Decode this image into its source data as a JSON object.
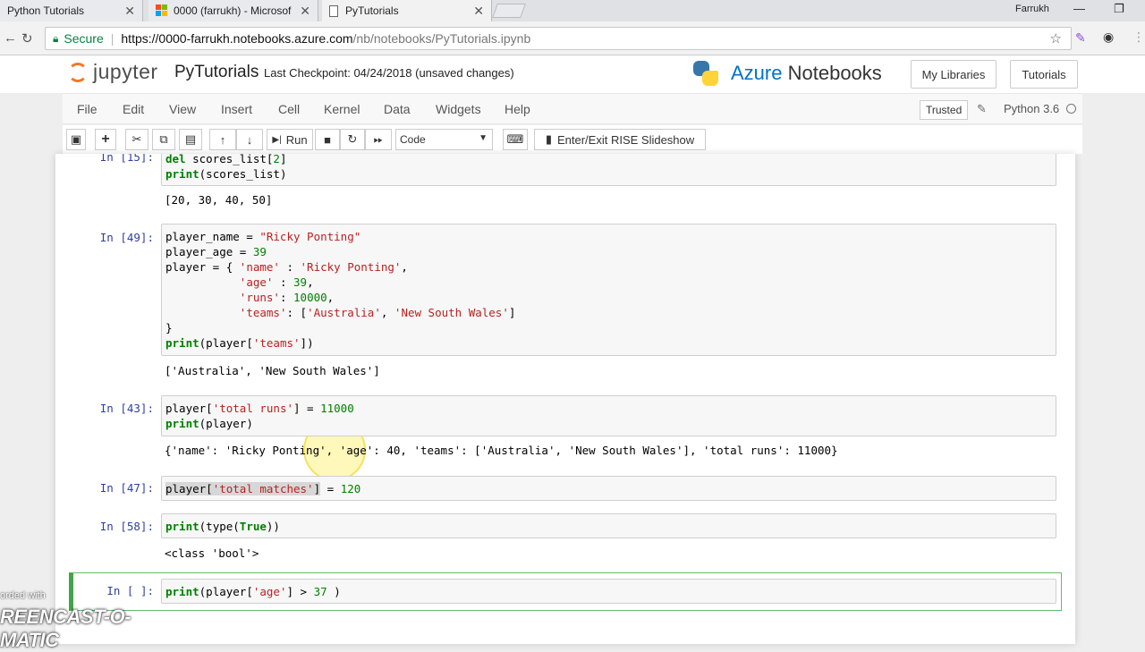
{
  "browser": {
    "tabs": [
      {
        "title": "Python Tutorials"
      },
      {
        "title": "0000 (farrukh) - Microsof"
      },
      {
        "title": "PyTutorials"
      }
    ],
    "user": "Farrukh",
    "secure_label": "Secure",
    "url_host": "https://0000-farrukh.notebooks.azure.com",
    "url_path": "/nb/notebooks/PyTutorials.ipynb"
  },
  "header": {
    "jupyter_word": "jupyter",
    "notebook_name": "PyTutorials",
    "checkpoint": "Last Checkpoint: 04/24/2018  (unsaved changes)",
    "azure_brand": "Azure",
    "azure_product": "Notebooks",
    "btn_libraries": "My Libraries",
    "btn_tutorials": "Tutorials"
  },
  "menu": {
    "items": [
      "File",
      "Edit",
      "View",
      "Insert",
      "Cell",
      "Kernel",
      "Data",
      "Widgets",
      "Help"
    ],
    "trusted": "Trusted",
    "kernel": "Python 3.6"
  },
  "toolbar": {
    "run": "Run",
    "cell_type": "Code",
    "rise": "Enter/Exit RISE Slideshow"
  },
  "cells": {
    "c15_prompt": "In [15]:",
    "c15_out": "[20, 30, 40, 50]",
    "c49_prompt": "In [49]:",
    "c49_out": "['Australia', 'New South Wales']",
    "c43_prompt": "In [43]:",
    "c43_out": "{'name': 'Ricky Ponting', 'age': 40, 'teams': ['Australia', 'New South Wales'], 'total runs': 11000}",
    "c47_prompt": "In [47]:",
    "c58_prompt": "In [58]:",
    "c58_out": "<class 'bool'>",
    "cnew_prompt": "In [ ]:"
  },
  "watermark": {
    "line1": "orded with",
    "line2": "REENCAST-O-MATIC"
  }
}
